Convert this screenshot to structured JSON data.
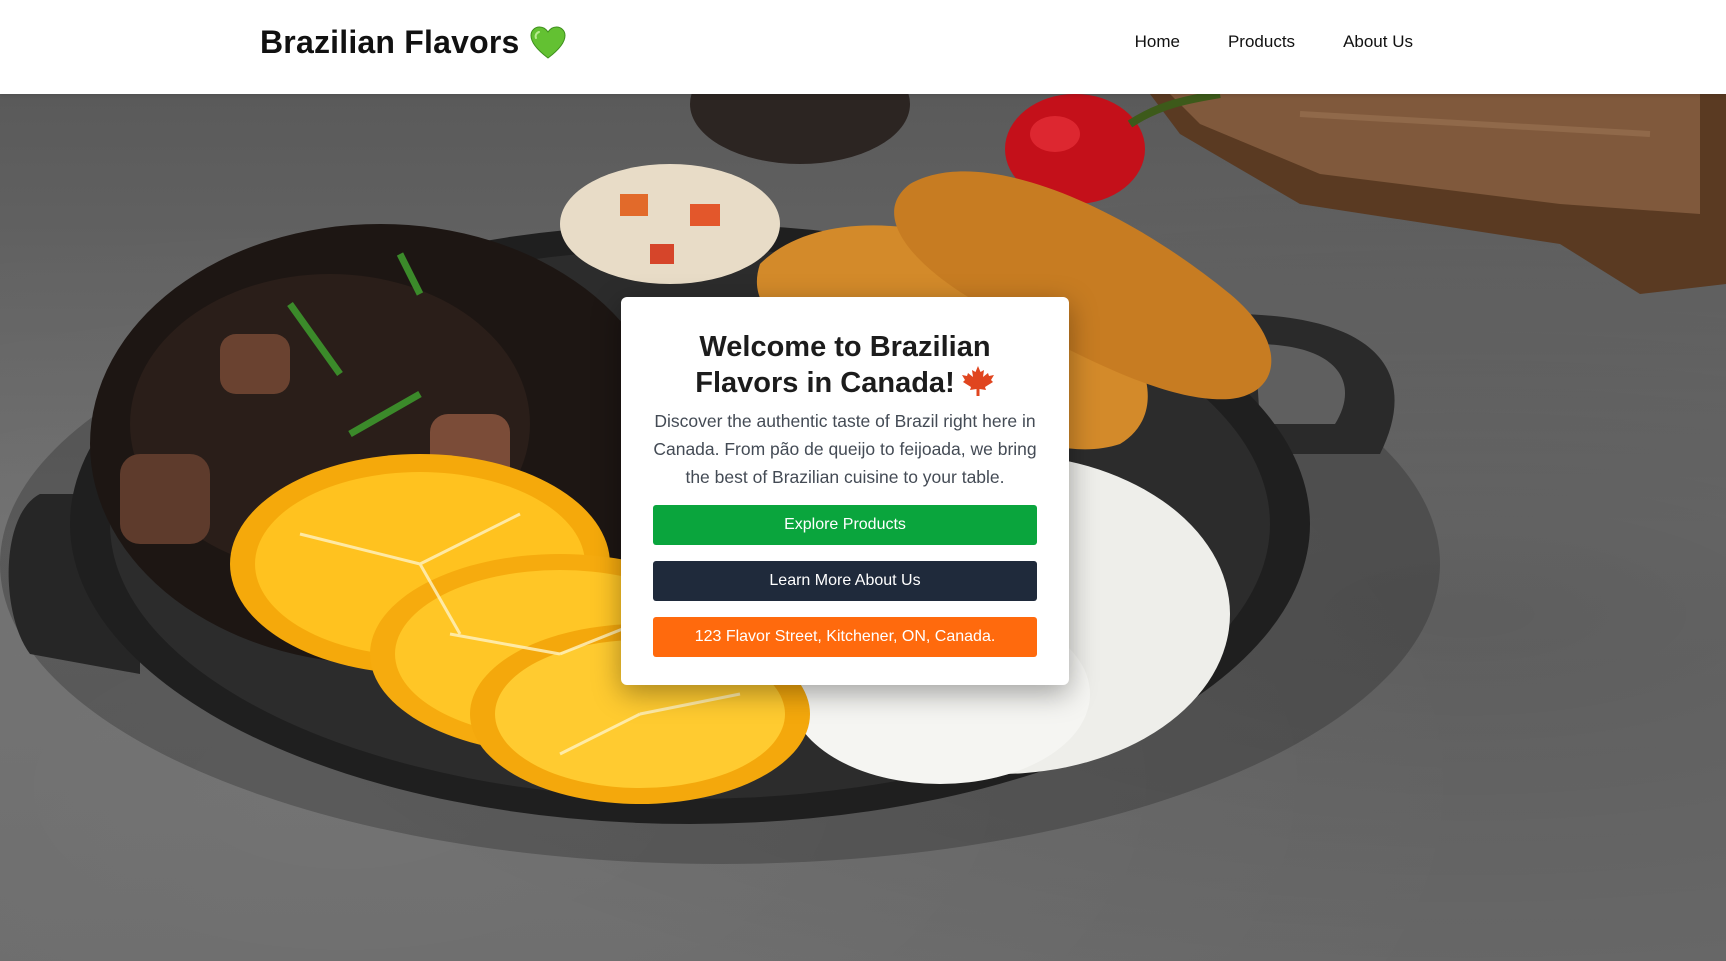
{
  "header": {
    "brand": "Brazilian Flavors",
    "brand_icon": "green-heart-icon",
    "nav": {
      "home": "Home",
      "products": "Products",
      "about": "About Us"
    }
  },
  "hero": {
    "background_image": "brazilian-feijoada-plate-photo",
    "card": {
      "title": "Welcome to Brazilian Flavors in Canada!",
      "title_icon": "maple-leaf-icon",
      "description": "Discover the authentic taste of Brazil right here in Canada. From pão de queijo to feijoada, we bring the best of Brazilian cuisine to your table.",
      "buttons": {
        "explore": "Explore Products",
        "learn": "Learn More About Us",
        "address": "123 Flavor Street, Kitchener, ON, Canada."
      }
    }
  },
  "colors": {
    "explore": "#0aa53d",
    "learn": "#1f2a3b",
    "address": "#ff6a0d",
    "heart": "#63c132",
    "leaf": "#e0451f"
  }
}
